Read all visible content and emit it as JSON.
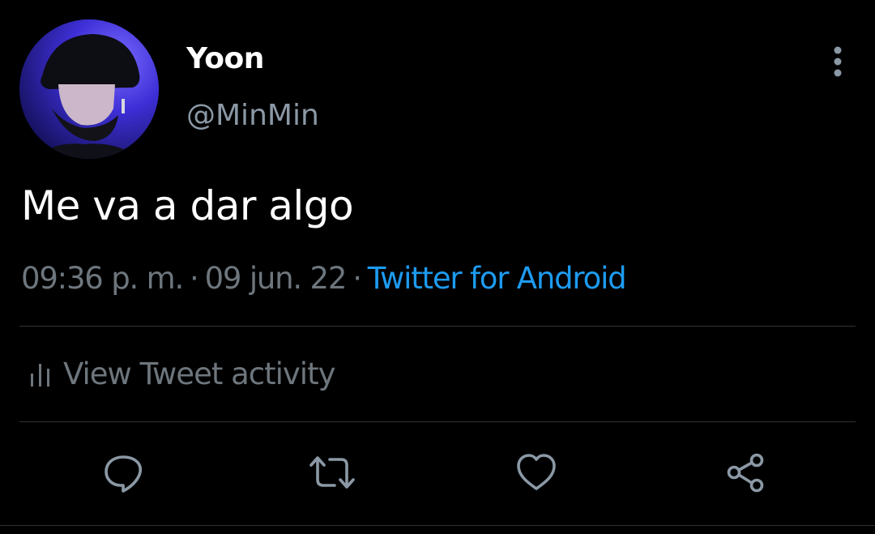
{
  "author": {
    "display_name": "Yoon",
    "handle": "@MinMin"
  },
  "tweet": {
    "text": "Me va a dar algo",
    "time": "09:36 p. m.",
    "separator": "·",
    "date": "09 jun. 22",
    "source": "Twitter for Android"
  },
  "activity": {
    "label": "View Tweet activity",
    "icon": "bar-chart-icon"
  },
  "actions": [
    {
      "name": "reply",
      "icon": "speech-bubble-icon"
    },
    {
      "name": "retweet",
      "icon": "retweet-arrows-icon"
    },
    {
      "name": "like",
      "icon": "heart-icon"
    },
    {
      "name": "share",
      "icon": "share-nodes-icon"
    }
  ],
  "menu": {
    "icon": "vertical-ellipsis-icon"
  },
  "colors": {
    "background": "#000000",
    "text_primary": "#ffffff",
    "text_secondary": "#6e767d",
    "handle": "#8b98a5",
    "link": "#1d9bf0",
    "divider": "#2f3336"
  }
}
